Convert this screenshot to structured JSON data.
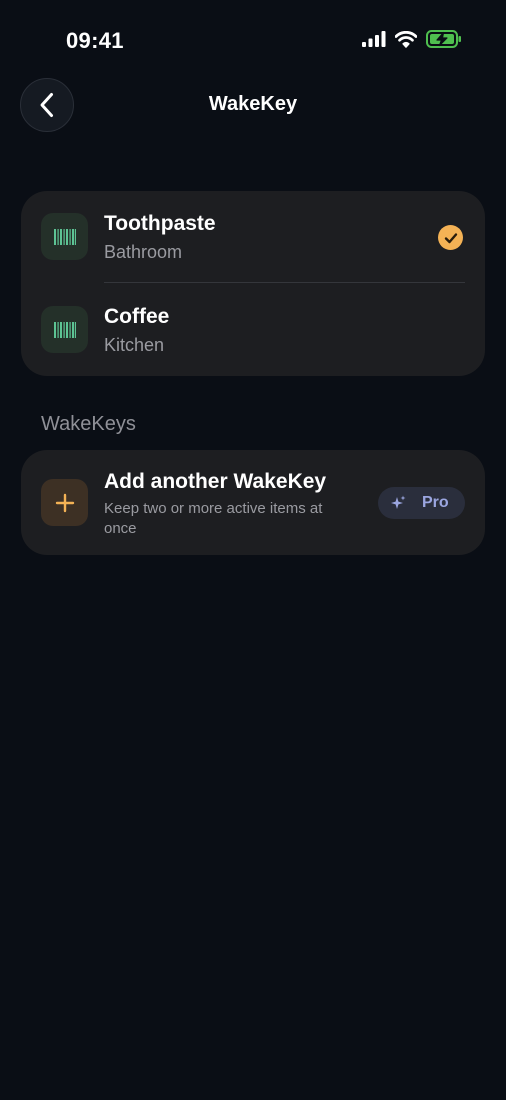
{
  "status_bar": {
    "time": "09:41"
  },
  "nav": {
    "title": "WakeKey"
  },
  "active_items": [
    {
      "title": "Toothpaste",
      "subtitle": "Bathroom",
      "selected": true
    },
    {
      "title": "Coffee",
      "subtitle": "Kitchen",
      "selected": false
    }
  ],
  "section": {
    "header": "WakeKeys"
  },
  "add_item": {
    "title": "Add another WakeKey",
    "subtitle": "Keep two or more active items at once",
    "badge_label": "Pro"
  },
  "colors": {
    "background": "#0a0e15",
    "card": "#1d1e21",
    "accent_orange": "#f4b255",
    "barcode_green": "#5dc394",
    "pro_purple": "#9ba6e0"
  },
  "icons": {
    "row_icon": "barcode-icon",
    "selected_indicator": "checkmark-icon",
    "add_icon": "plus-icon",
    "pro_icon": "sparkle-icon"
  }
}
